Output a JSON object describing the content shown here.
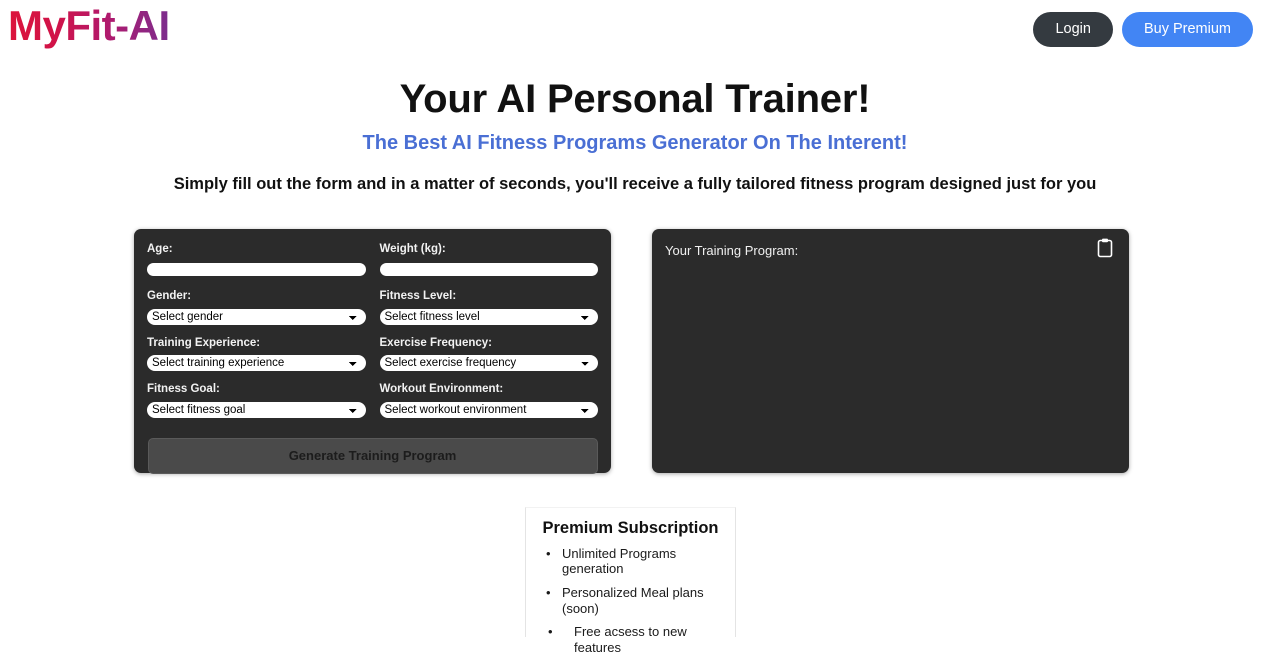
{
  "header": {
    "logo": "MyFit-AI",
    "login_label": "Login",
    "premium_label": "Buy Premium",
    "login_color": "#343a40",
    "premium_color": "#4285f4",
    "logo_gradient_from": "#dc143c",
    "logo_gradient_to": "#7b2d8e"
  },
  "hero": {
    "title": "Your AI Personal Trainer!",
    "subtitle": "The Best AI Fitness Programs Generator On The Interent!",
    "subtitle_color": "#4a6fd4",
    "description": "Simply fill out the form and in a matter of seconds, you'll receive a fully tailored fitness program designed just for you"
  },
  "form": {
    "fields": [
      {
        "label": "Age:",
        "type": "text",
        "value": "",
        "placeholder": ""
      },
      {
        "label": "Weight (kg):",
        "type": "text",
        "value": "",
        "placeholder": ""
      },
      {
        "label": "Gender:",
        "type": "select",
        "value": "Select gender"
      },
      {
        "label": "Fitness Level:",
        "type": "select",
        "value": "Select fitness level"
      },
      {
        "label": "Training Experience:",
        "type": "select",
        "value": "Select training experience"
      },
      {
        "label": "Exercise Frequency:",
        "type": "select",
        "value": "Select exercise frequency"
      },
      {
        "label": "Fitness Goal:",
        "type": "select",
        "value": "Select fitness goal"
      },
      {
        "label": "Workout Environment:",
        "type": "select",
        "value": "Select workout environment"
      }
    ],
    "submit_label": "Generate Training Program",
    "panel_color": "#2b2b2b",
    "submit_color": "#4a4a4a"
  },
  "output": {
    "label": "Your Training Program:",
    "content": "",
    "copy_icon": "clipboard-icon"
  },
  "premium": {
    "title": "Premium Subscription",
    "features": [
      "Unlimited Programs generation",
      "Personalized Meal plans (soon)",
      "Free acsess to new features"
    ]
  }
}
